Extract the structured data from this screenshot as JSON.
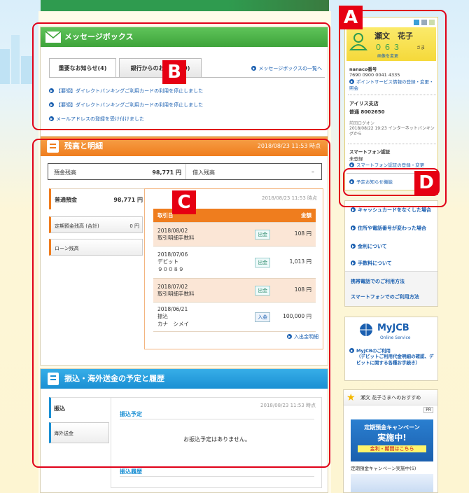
{
  "header": {},
  "message_box": {
    "title": "メッセージボックス",
    "tabs": [
      {
        "label": "重要なお知らせ(4)"
      },
      {
        "label": "銀行からのお知らせ(0)"
      }
    ],
    "list_link": "メッセージボックスの一覧へ",
    "items": [
      "【要領】ダイレクトバンキングご利用カードの利用を停止しました",
      "【要領】ダイレクトバンキングご利用カードの利用を停止しました",
      "メールアドレスの登録を受け付けました"
    ]
  },
  "balance": {
    "title": "残高と明細",
    "timestamp": "2018/08/23 11:53 時点",
    "deposit_label": "預金残高",
    "deposit_value": "98,771 円",
    "loan_label": "借入残高",
    "loan_value": "–",
    "accounts": [
      {
        "name": "普通預金",
        "value": "98,771 円"
      },
      {
        "name": "定期預金残高 (合計)",
        "value": "0 円"
      },
      {
        "name": "ローン残高",
        "value": ""
      }
    ],
    "detail_timestamp": "2018/08/23 11:53 時点",
    "columns": [
      "取引日",
      "金額"
    ],
    "rows": [
      {
        "date": "2018/08/02",
        "desc": "取引明細手数料",
        "desc2": "",
        "type": "出金",
        "amount": "108 円"
      },
      {
        "date": "2018/07/06",
        "desc": "デビット",
        "desc2": "９００８９",
        "type": "出金",
        "amount": "1,013 円"
      },
      {
        "date": "2018/07/02",
        "desc": "取引明細手数料",
        "desc2": "",
        "type": "出金",
        "amount": "108 円"
      },
      {
        "date": "2018/06/21",
        "desc": "振込",
        "desc2": "カナ　シメイ",
        "type": "入金",
        "amount": "100,000 円"
      }
    ],
    "more_link": "入出金明細"
  },
  "transfer": {
    "title": "振込・海外送金の予定と履歴",
    "tabs": [
      "振込",
      "海外送金"
    ],
    "timestamp": "2018/08/23 11:53 時点",
    "scheduled_label": "振込予定",
    "none_text": "お振込予定はありません。",
    "history_label": "振込履歴"
  },
  "user": {
    "name": "瀬文　花子",
    "points": "０６３",
    "suffix": "さま",
    "change_link": "画像を変更",
    "nanaco_label": "nanaco番号",
    "nanaco_number": "7690 0900 0041 4335",
    "point_link": "ポイントサービス情報の登録・変更・照会",
    "branch_name": "アイリス支店",
    "account": "普通 8002650",
    "last_login_label": "前回ログオン",
    "last_login": "2018/08/22 19:23 インターネットバンキングから",
    "smartphone_label": "スマートフォン認証",
    "smartphone_status": "未登録",
    "smartphone_link": "スマートフォン認証の登録・変更",
    "notice_link": "予定お知らせ機能"
  },
  "side_links": [
    "キャッシュカードをなくした場合",
    "住所や電話番号が変わった場合",
    "金利について",
    "手数料について",
    "携帯電話でのご利用方法",
    "スマートフォンでのご利用方法"
  ],
  "myjcb": {
    "logo": "MyJCB",
    "sub": "Online Service",
    "link": "MyJCBのご利用",
    "desc": "（デビットご利用代金明細の確認、デビットに関する各種お手続き）"
  },
  "recommend": {
    "title": "瀬文 花子さまへのおすすめ",
    "pr": "PR",
    "banner_line1": "定期預金キャンペーン",
    "banner_line2": "実施中!",
    "banner_line3": "金利・期間はこちら",
    "caption": "定期預金キャンペーン実施中(S)"
  },
  "markers": [
    "A",
    "B",
    "C",
    "D"
  ],
  "colors": {
    "red": "#e00018",
    "green": "#3ea33a",
    "orange": "#ef7d1e",
    "blue": "#1a8fd3",
    "link": "#1a5fb0"
  }
}
